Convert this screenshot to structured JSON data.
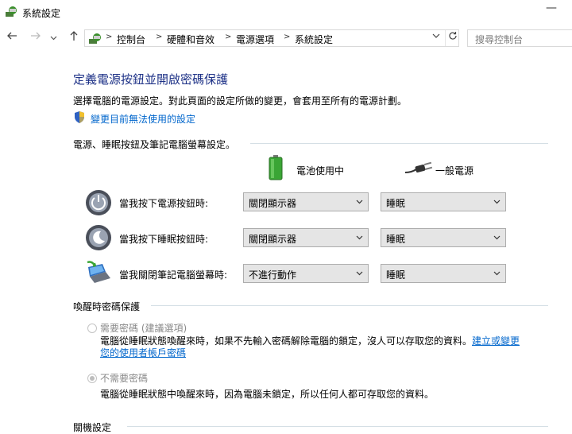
{
  "window": {
    "title": "系統設定",
    "minimize_glyph": "—"
  },
  "nav": {
    "breadcrumbs": [
      "控制台",
      "硬體和音效",
      "電源選項",
      "系統設定"
    ],
    "search_placeholder": "搜尋控制台"
  },
  "main": {
    "heading": "定義電源按鈕並開啟密碼保護",
    "description": "選擇電腦的電源設定。對此頁面的設定所做的變更，會套用至所有的電源計劃。",
    "change_settings_link": "變更目前無法使用的設定",
    "buttons_section": {
      "title": "電源、睡眠按鈕及筆記電腦螢幕設定。",
      "col_battery": "電池使用中",
      "col_plugged": "一般電源",
      "rows": [
        {
          "label": "當我按下電源按鈕時:",
          "battery": "關閉顯示器",
          "plugged": "睡眠",
          "icon": "power-button-icon"
        },
        {
          "label": "當我按下睡眠按鈕時:",
          "battery": "關閉顯示器",
          "plugged": "睡眠",
          "icon": "sleep-button-icon"
        },
        {
          "label": "當我關閉筆記電腦螢幕時:",
          "battery": "不進行動作",
          "plugged": "睡眠",
          "icon": "laptop-lid-icon"
        }
      ]
    },
    "wakeup_section": {
      "title": "喚醒時密碼保護",
      "require_label": "需要密碼 (建議選項)",
      "require_desc": "電腦從睡眠狀態喚醒來時，如果不先輸入密碼解除電腦的鎖定，沒人可以存取您的資料。",
      "require_link_a": "建立或變更",
      "require_link_b": "您的使用者帳戶密碼",
      "no_require_label": "不需要密碼",
      "no_require_desc": "電腦從睡眠狀態中喚醒來時，因為電腦未鎖定，所以任何人都可存取您的資料。"
    },
    "shutdown_section": {
      "title": "關機設定"
    }
  },
  "colors": {
    "heading": "#1e3287",
    "link": "#0066cc",
    "dropdown_bg": "#e5e5e5"
  }
}
